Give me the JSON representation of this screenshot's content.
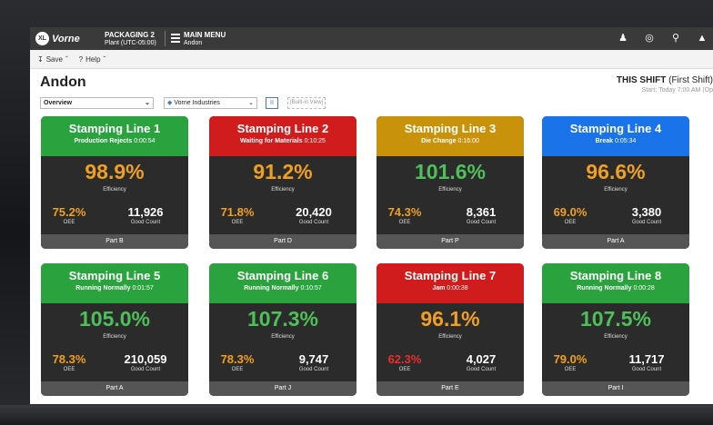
{
  "app": {
    "logo": "Vorne",
    "logo_badge": "XL",
    "device_name": "PACKAGING 2",
    "device_sub": "Plant (UTC-05:00)",
    "menu_title": "MAIN MENU",
    "menu_sub": "Andon"
  },
  "toolbar": {
    "save": "Save",
    "help": "Help"
  },
  "page": {
    "title": "Andon",
    "shift_label": "THIS SHIFT",
    "shift_name": "(First Shift)",
    "shift_start": "Start: Today 7:00 AM (Op"
  },
  "filters": {
    "view": "Overview",
    "company": "Vorne Industries",
    "pause": "II",
    "builtin": "[Built-in View]"
  },
  "colors": {
    "green": "#2aa23d",
    "red": "#d01c1c",
    "amber": "#c8920a",
    "blue": "#1a73e8",
    "orange_text": "#f0a020",
    "green_text": "#4ec05a",
    "red_text": "#e53030"
  },
  "cards": [
    {
      "title": "Stamping Line 1",
      "status": "Production Rejects",
      "time": "0:00:54",
      "efficiency": "98.9%",
      "eff_label": "Efficiency",
      "oee": "75.2%",
      "oee_label": "OEE",
      "good_count": "11,926",
      "gc_label": "Good Count",
      "part": "Part B",
      "head_color": "green",
      "eff_color": "orange",
      "oee_color": "orange"
    },
    {
      "title": "Stamping Line 2",
      "status": "Waiting for Materials",
      "time": "0:10:25",
      "efficiency": "91.2%",
      "eff_label": "Efficiency",
      "oee": "71.8%",
      "oee_label": "OEE",
      "good_count": "20,420",
      "gc_label": "Good Count",
      "part": "Part D",
      "head_color": "red",
      "eff_color": "orange",
      "oee_color": "orange"
    },
    {
      "title": "Stamping Line 3",
      "status": "Die Change",
      "time": "0:16:00",
      "efficiency": "101.6%",
      "eff_label": "Efficiency",
      "oee": "74.3%",
      "oee_label": "OEE",
      "good_count": "8,361",
      "gc_label": "Good Count",
      "part": "Part P",
      "head_color": "amber",
      "eff_color": "green",
      "oee_color": "orange"
    },
    {
      "title": "Stamping Line 4",
      "status": "Break",
      "time": "0:05:34",
      "efficiency": "96.6%",
      "eff_label": "Efficiency",
      "oee": "69.0%",
      "oee_label": "OEE",
      "good_count": "3,380",
      "gc_label": "Good Count",
      "part": "Part A",
      "head_color": "blue",
      "eff_color": "orange",
      "oee_color": "orange"
    },
    {
      "title": "Stamping Line 5",
      "status": "Running Normally",
      "time": "0:01:57",
      "efficiency": "105.0%",
      "eff_label": "Efficiency",
      "oee": "78.3%",
      "oee_label": "OEE",
      "good_count": "210,059",
      "gc_label": "Good Count",
      "part": "Part A",
      "head_color": "green",
      "eff_color": "green",
      "oee_color": "orange"
    },
    {
      "title": "Stamping Line 6",
      "status": "Running Normally",
      "time": "0:10:57",
      "efficiency": "107.3%",
      "eff_label": "Efficiency",
      "oee": "78.3%",
      "oee_label": "OEE",
      "good_count": "9,747",
      "gc_label": "Good Count",
      "part": "Part J",
      "head_color": "green",
      "eff_color": "green",
      "oee_color": "orange"
    },
    {
      "title": "Stamping Line 7",
      "status": "Jam",
      "time": "0:00:38",
      "efficiency": "96.1%",
      "eff_label": "Efficiency",
      "oee": "62.3%",
      "oee_label": "OEE",
      "good_count": "4,027",
      "gc_label": "Good Count",
      "part": "Part E",
      "head_color": "red",
      "eff_color": "orange",
      "oee_color": "red"
    },
    {
      "title": "Stamping Line 8",
      "status": "Running Normally",
      "time": "0:00:28",
      "efficiency": "107.5%",
      "eff_label": "Efficiency",
      "oee": "79.0%",
      "oee_label": "OEE",
      "good_count": "11,717",
      "gc_label": "Good Count",
      "part": "Part I",
      "head_color": "green",
      "eff_color": "green",
      "oee_color": "orange"
    }
  ]
}
